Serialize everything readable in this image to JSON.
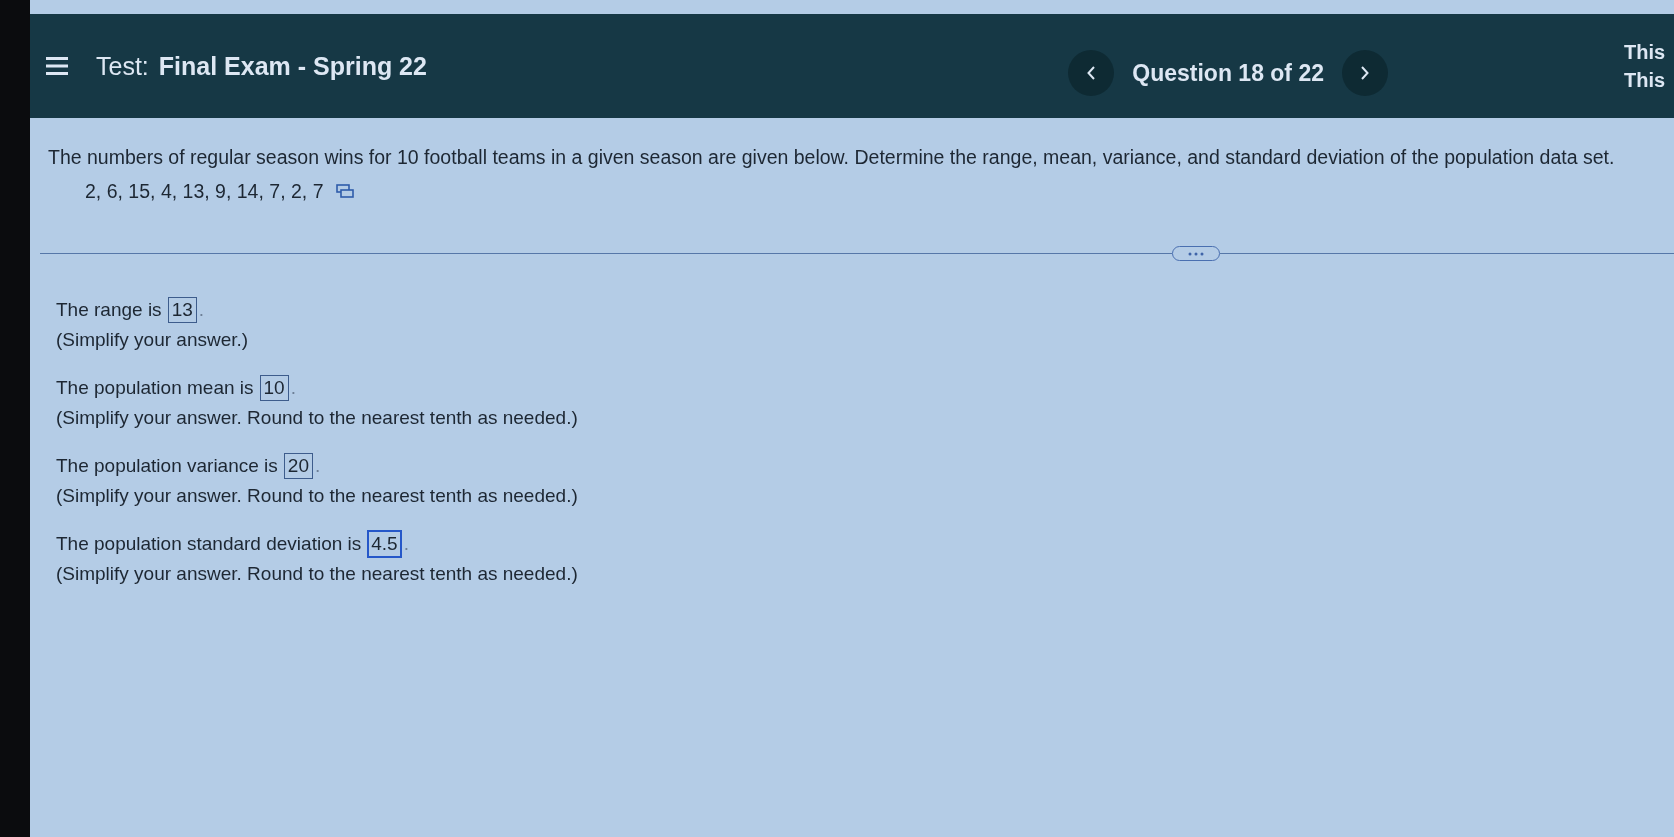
{
  "header": {
    "title_prefix": "Test:",
    "title": "Final Exam - Spring 22",
    "question_counter": "Question 18 of 22",
    "side_text": [
      "This",
      "This"
    ]
  },
  "question": {
    "text": "The numbers of regular season wins for 10 football teams in a given season are given below. Determine the range, mean, variance, and standard deviation of the population data set.",
    "data": "2, 6, 15, 4, 13, 9, 14, 7, 2, 7"
  },
  "answers": [
    {
      "prompt": "The range is",
      "value": "13",
      "suffix": ".",
      "hint": "(Simplify your answer.)",
      "focused": false
    },
    {
      "prompt": "The population mean is",
      "value": "10",
      "suffix": ".",
      "hint": "(Simplify your answer. Round to the nearest tenth as needed.)",
      "focused": false
    },
    {
      "prompt": "The population variance is",
      "value": "20",
      "suffix": ".",
      "hint": "(Simplify your answer. Round to the nearest tenth as needed.)",
      "focused": false
    },
    {
      "prompt": "The population standard deviation is",
      "value": "4.5",
      "suffix": ".",
      "hint": "(Simplify your answer. Round to the nearest tenth as needed.)",
      "focused": true
    }
  ]
}
